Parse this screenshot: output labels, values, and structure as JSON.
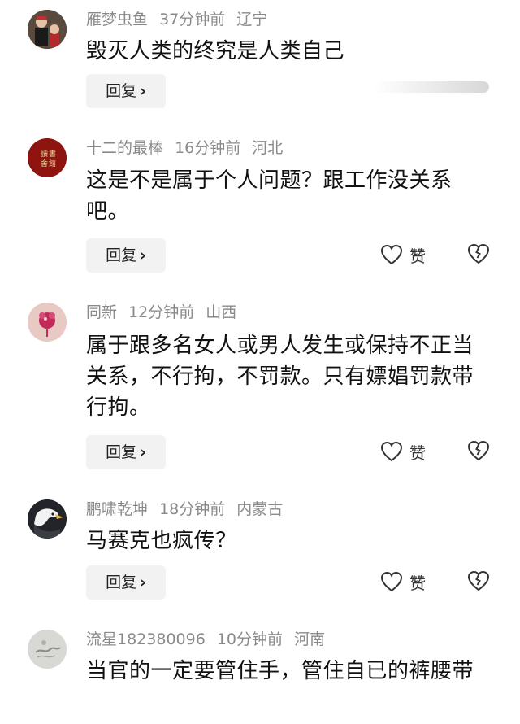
{
  "comments": [
    {
      "username": "雁梦虫鱼",
      "time": "37分钟前",
      "location": "辽宁",
      "text": "毁灭人类的终究是人类自己",
      "reply_label": "回复",
      "like_label": ""
    },
    {
      "username": "十二的最棒",
      "time": "16分钟前",
      "location": "河北",
      "text": "这是不是属于个人问题？跟工作没关系吧。",
      "reply_label": "回复",
      "like_label": "赞"
    },
    {
      "username": "同新",
      "time": "12分钟前",
      "location": "山西",
      "text": "属于跟多名女人或男人发生或保持不正当关系，不行拘，不罚款。只有嫖娼罚款带行拘。",
      "reply_label": "回复",
      "like_label": "赞"
    },
    {
      "username": "鹏啸乾坤",
      "time": "18分钟前",
      "location": "内蒙古",
      "text": "马赛克也疯传？",
      "reply_label": "回复",
      "like_label": "赞"
    },
    {
      "username": "流星182380096",
      "time": "10分钟前",
      "location": "河南",
      "text": "当官的一定要管住手，管住自已的裤腰带",
      "reply_label": "回复",
      "like_label": ""
    }
  ],
  "icons": {
    "like": "heart-outline-icon",
    "dislike": "broken-heart-icon",
    "chevron": "chevron-right-icon"
  },
  "colors": {
    "meta": "#8a8a8a",
    "text": "#111111",
    "reply_bg": "#f2f2f2"
  }
}
